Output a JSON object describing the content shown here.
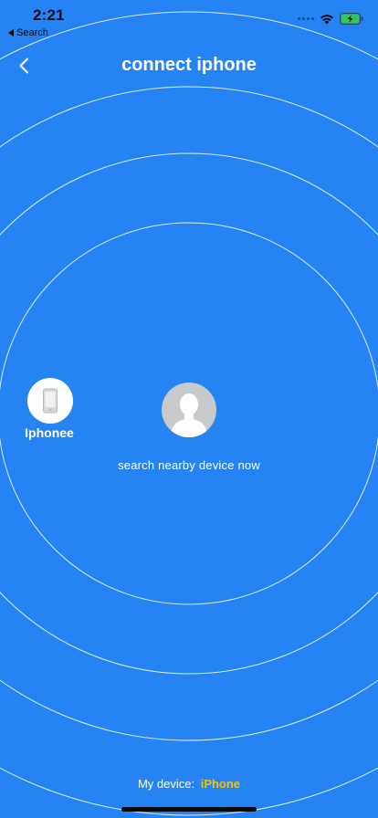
{
  "status_bar": {
    "time": "2:21",
    "back_app_label": "Search",
    "back_icon": "back-triangle-icon",
    "signal_icon": "cellular-signal-icon",
    "wifi_icon": "wifi-icon",
    "battery_icon": "battery-charging-icon",
    "battery_color": "#34c759"
  },
  "header": {
    "title": "connect iphone",
    "back_icon": "chevron-left-icon"
  },
  "radar": {
    "found_device": {
      "name": "Iphonee",
      "icon": "phone-icon"
    },
    "user_icon": "user-silhouette-icon",
    "status_text": "search nearby device now"
  },
  "footer": {
    "my_device_label": "My device:",
    "my_device_value": "iPhone",
    "my_device_value_color": "#f5c400"
  },
  "colors": {
    "background": "#2583f4",
    "ring": "#ffffff",
    "avatar_gray": "#c8c9cb"
  }
}
